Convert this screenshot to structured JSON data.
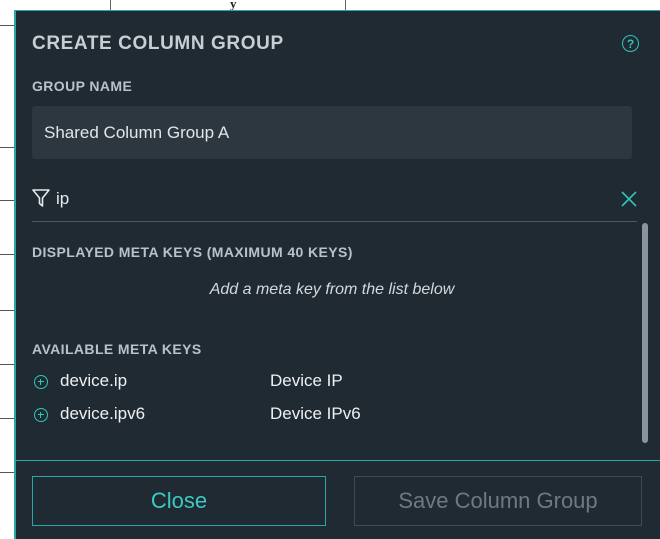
{
  "background": {
    "top_text": "y"
  },
  "modal": {
    "title": "CREATE COLUMN GROUP",
    "help_icon": "?",
    "group_name_label": "GROUP NAME",
    "group_name_value": "Shared Column Group A",
    "filter_value": "ip",
    "displayed_label": "DISPLAYED META KEYS (MAXIMUM 40 KEYS)",
    "empty_message": "Add a meta key from the list below",
    "available_label": "AVAILABLE META KEYS",
    "available_keys": [
      {
        "key": "device.ip",
        "description": "Device IP"
      },
      {
        "key": "device.ipv6",
        "description": "Device IPv6"
      }
    ],
    "close_label": "Close",
    "save_label": "Save Column Group"
  },
  "colors": {
    "accent": "#2aa6a6",
    "panel_bg": "#1f2a33",
    "input_bg": "#2c3740",
    "disabled_text": "#6e7a83"
  }
}
